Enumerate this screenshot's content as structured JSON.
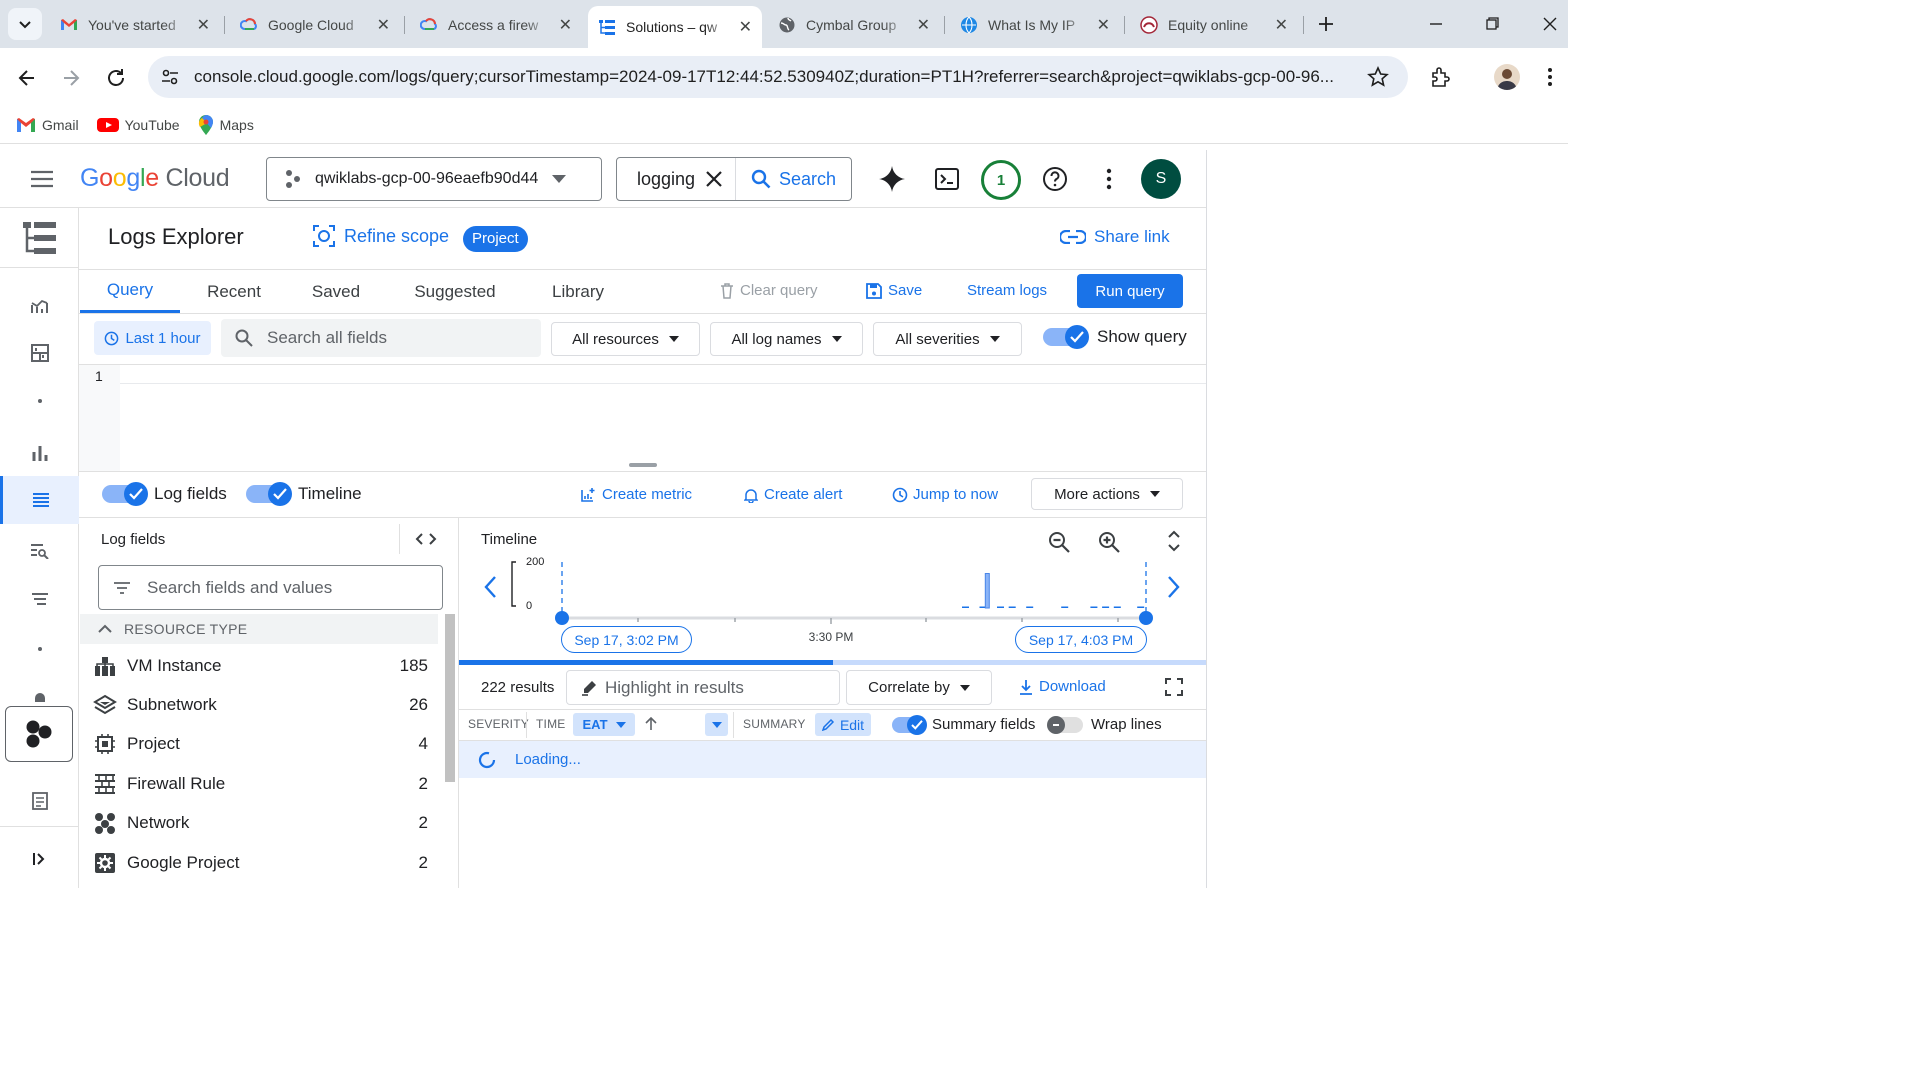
{
  "browser": {
    "tabs": [
      {
        "title": "You've started",
        "icon": "gmail-favicon",
        "active": false
      },
      {
        "title": "Google Cloud",
        "icon": "google-cloud-favicon",
        "active": false
      },
      {
        "title": "Access a firew",
        "icon": "google-cloud-favicon",
        "active": false
      },
      {
        "title": "Solutions – qw",
        "icon": "logs-favicon",
        "active": true
      },
      {
        "title": "Cymbal Group",
        "icon": "globe-favicon",
        "active": false
      },
      {
        "title": "What Is My IP",
        "icon": "whatismyip-favicon",
        "active": false
      },
      {
        "title": "Equity online",
        "icon": "equity-favicon",
        "active": false
      }
    ],
    "url": "console.cloud.google.com/logs/query;cursorTimestamp=2024-09-17T12:44:52.530940Z;duration=PT1H?referrer=search&project=qwiklabs-gcp-00-96...",
    "bookmarks": [
      {
        "label": "Gmail",
        "icon": "gmail-icon"
      },
      {
        "label": "YouTube",
        "icon": "youtube-icon"
      },
      {
        "label": "Maps",
        "icon": "maps-icon"
      }
    ]
  },
  "console": {
    "logo_google": "Google",
    "logo_cloud": "Cloud",
    "project": "qwiklabs-gcp-00-96eaefb90d44",
    "search_value": "logging",
    "search_button": "Search",
    "notification_count": "1",
    "avatar_letter": "S"
  },
  "logs": {
    "page_title": "Logs Explorer",
    "refine_scope": "Refine scope",
    "scope_badge": "Project",
    "share_link": "Share link",
    "tabs": [
      "Query",
      "Recent",
      "Saved",
      "Suggested",
      "Library"
    ],
    "active_tab": "Query",
    "clear_query": "Clear query",
    "save": "Save",
    "stream_logs": "Stream logs",
    "run_query": "Run query",
    "time_range": "Last 1 hour",
    "search_placeholder": "Search all fields",
    "all_resources": "All resources",
    "all_log_names": "All log names",
    "all_severities": "All severities",
    "show_query": "Show query",
    "line_number": "1",
    "log_fields_toggle": "Log fields",
    "timeline_toggle": "Timeline",
    "create_metric": "Create metric",
    "create_alert": "Create alert",
    "jump_to_now": "Jump to now",
    "more_actions": "More actions"
  },
  "log_fields": {
    "title": "Log fields",
    "search_placeholder": "Search fields and values",
    "section": "RESOURCE TYPE",
    "items": [
      {
        "name": "VM Instance",
        "count": "185",
        "icon": "vm-instance-icon"
      },
      {
        "name": "Subnetwork",
        "count": "26",
        "icon": "subnetwork-icon"
      },
      {
        "name": "Project",
        "count": "4",
        "icon": "project-chip-icon"
      },
      {
        "name": "Firewall Rule",
        "count": "2",
        "icon": "firewall-icon"
      },
      {
        "name": "Network",
        "count": "2",
        "icon": "network-icon"
      },
      {
        "name": "Google Project",
        "count": "2",
        "icon": "google-project-icon"
      }
    ]
  },
  "timeline": {
    "title": "Timeline",
    "y_max_label": "200",
    "y_min_label": "0",
    "start_label": "Sep 17, 3:02 PM",
    "mid_label": "3:30 PM",
    "end_label": "Sep 17, 4:03 PM",
    "bars": [
      {
        "position": 0.69,
        "value": 6
      },
      {
        "position": 0.72,
        "value": 6
      },
      {
        "position": 0.73,
        "value": 150
      },
      {
        "position": 0.75,
        "value": 6
      },
      {
        "position": 0.77,
        "value": 6
      },
      {
        "position": 0.8,
        "value": 6
      },
      {
        "position": 0.86,
        "value": 6
      },
      {
        "position": 0.91,
        "value": 6
      },
      {
        "position": 0.93,
        "value": 6
      },
      {
        "position": 0.95,
        "value": 6
      },
      {
        "position": 0.99,
        "value": 6
      }
    ],
    "y_max": 200
  },
  "results": {
    "count_label": "222 results",
    "highlight_placeholder": "Highlight in results",
    "correlate_by": "Correlate by",
    "download": "Download",
    "col_severity": "SEVERITY",
    "col_time": "TIME",
    "timezone": "EAT",
    "col_summary": "SUMMARY",
    "edit": "Edit",
    "summary_fields": "Summary fields",
    "wrap_lines": "Wrap lines",
    "loading": "Loading...",
    "loading_progress": 0.5
  },
  "colors": {
    "accent": "#1a73e8",
    "tabstrip": "#dde3ea",
    "omnibox": "#e9eef6"
  }
}
